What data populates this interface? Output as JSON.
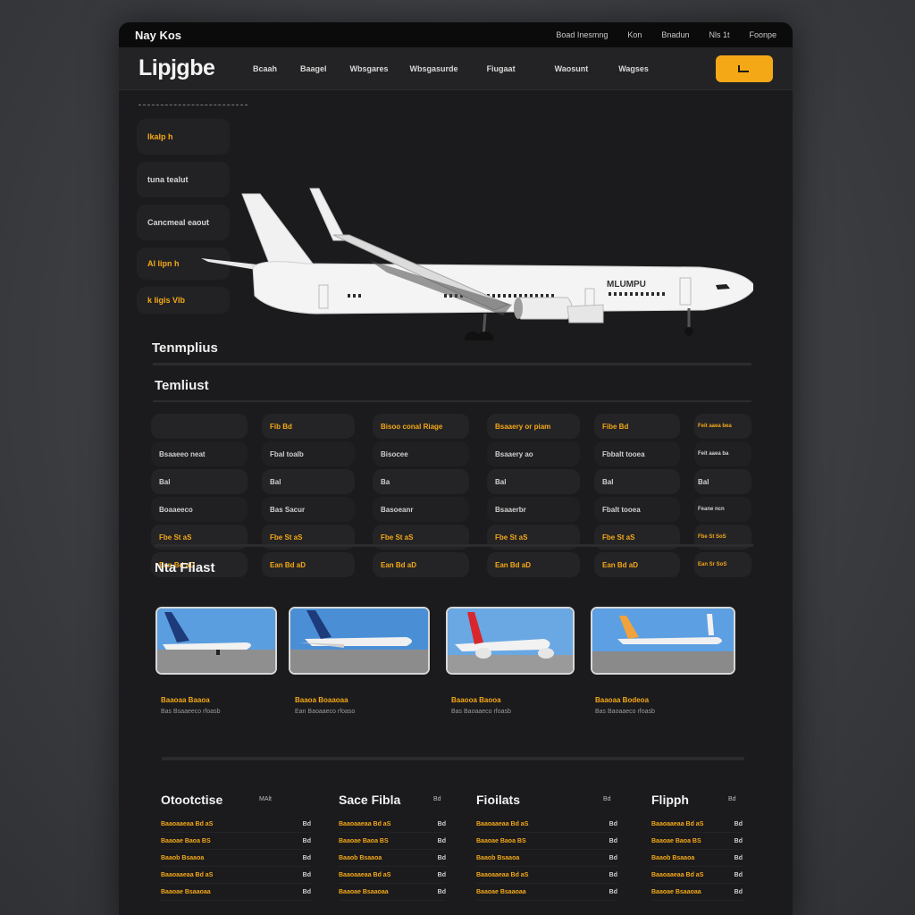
{
  "titlebar": {
    "app_name": "Nay Kos",
    "links": [
      "Boad Inesmng",
      "Kon",
      "Bnadun",
      "Nls 1t",
      "Foonpe"
    ]
  },
  "navbar": {
    "brand": "Lipjgbe",
    "items": [
      "Bcaah",
      "Baagel",
      "Wbsgares",
      "Wbsgasurde",
      "Fiugaat",
      "Waosunt",
      "Wagses"
    ],
    "cta_icon": "arrow-icon"
  },
  "side_menu": {
    "items": [
      {
        "label": "Ikalp  h",
        "accent": true
      },
      {
        "label": "tuna tealut",
        "accent": false
      },
      {
        "label": "Cancmeal eaout",
        "accent": false
      },
      {
        "label": "Al lipn  h",
        "accent": true
      },
      {
        "label": "k Iigis      Vlb",
        "accent": true
      }
    ]
  },
  "sections": {
    "templates_title": "Tenmplius",
    "timelist_title": "Temliust",
    "fleet_title": "Nta Fliast"
  },
  "schedule": {
    "columns": [
      {
        "head": "",
        "rows": [
          "Bsaaeeo neat",
          "Bal",
          "Boaaeeco",
          "Fbe  St aS",
          "Ean  Bd aD"
        ]
      },
      {
        "head": "Fib  Bd",
        "rows": [
          "Fbal toalb",
          "Bal",
          "Bas Sacur",
          "Fbe  St aS",
          "Ean  Bd aD"
        ]
      },
      {
        "head": "Bisoo  conal  Riage",
        "rows": [
          "Bisocee",
          "Ba",
          "Basoeanr",
          "Fbe  St aS",
          "Ean  Bd aD"
        ]
      },
      {
        "head": "Bsaaery  or  piam",
        "rows": [
          "Bsaaery ao",
          "Bal",
          "Bsaaerbr",
          "Fbe  St aS",
          "Ean  Bd aD"
        ]
      },
      {
        "head": "Fibe  Bd",
        "rows": [
          "Fbbalt tooea",
          "Bal",
          "Fbalt tooea",
          "Fbe  St aS",
          "Ean  Bd aD"
        ]
      },
      {
        "head": "Feit  aaea  bea",
        "rows": [
          "Feit  aaea  ba",
          "Bal",
          "Feane  ncn",
          "Fbe  St   SoS",
          "Ean  Sr   SoS"
        ]
      }
    ]
  },
  "fleet": [
    {
      "title": "Baaoaa  Baaoa",
      "sub": "Bas  Bsaaeeco  rfoasb",
      "tail": "#1d3a7a",
      "sky": "#5a9ee0"
    },
    {
      "title": "Baaoa  Boaaoaa",
      "sub": "Ean  Baoaaeco  rfoaso",
      "tail": "#1d3a7a",
      "sky": "#4a8fd6"
    },
    {
      "title": "Baaooa  Baooa",
      "sub": "Bas  Baoaaeco  rfoasb",
      "tail": "#d8262c",
      "sky": "#6aa8e4"
    },
    {
      "title": "Baaoaa  Bodeoa",
      "sub": "Bas  Baoaaeco  rfoasb",
      "tail": "#f2a23a",
      "sky": "#5c9fe2"
    }
  ],
  "footer": [
    {
      "title": "Otootctise",
      "head_right": "MAlt",
      "rows": [
        [
          "Baaoaaeaa  Bd  aS",
          "Bd"
        ],
        [
          "Baaoae  Baoa  BS",
          "Bd"
        ],
        [
          "Baaob  Bsaaoa",
          "Bd"
        ],
        [
          "Baaoaaeaa  Bd  aS",
          "Bd"
        ],
        [
          "Baaoae  Bsaaoaa",
          "Bd"
        ]
      ]
    },
    {
      "title": "Sace Fibla",
      "head_right": "Bd",
      "rows": [
        [
          "Baaoaaeaa  Bd  aS",
          "Bd"
        ],
        [
          "Baaoae  Baoa  BS",
          "Bd"
        ],
        [
          "Baaob  Bsaaoa",
          "Bd"
        ],
        [
          "Baaoaaeaa  Bd  aS",
          "Bd"
        ],
        [
          "Baaoae  Bsaaoaa",
          "Bd"
        ]
      ]
    },
    {
      "title": "Fioilats",
      "head_right": "Bd",
      "rows": [
        [
          "Baaoaaeaa  Bd  aS",
          "Bd"
        ],
        [
          "Baaoae  Baoa  BS",
          "Bd"
        ],
        [
          "Baaob  Bsaaoa",
          "Bd"
        ],
        [
          "Baaoaaeaa  Bd  aS",
          "Bd"
        ],
        [
          "Baaoae  Bsaaoaa",
          "Bd"
        ]
      ]
    },
    {
      "title": "Flipph",
      "head_right": "Bd",
      "rows": [
        [
          "Baaoaaeaa  Bd  aS",
          "Bd"
        ],
        [
          "Baaoae  Baoa  BS",
          "Bd"
        ],
        [
          "Baaob  Bsaaoa",
          "Bd"
        ],
        [
          "Baaoaaeaa  Bd  aS",
          "Bd"
        ],
        [
          "Baaoae  Bsaaoaa",
          "Bd"
        ]
      ]
    }
  ],
  "hero": {
    "aircraft_mark": "MLUMPU",
    "colors": {
      "accent": "#f5a816",
      "fuselage": "#f4f4f4"
    }
  }
}
